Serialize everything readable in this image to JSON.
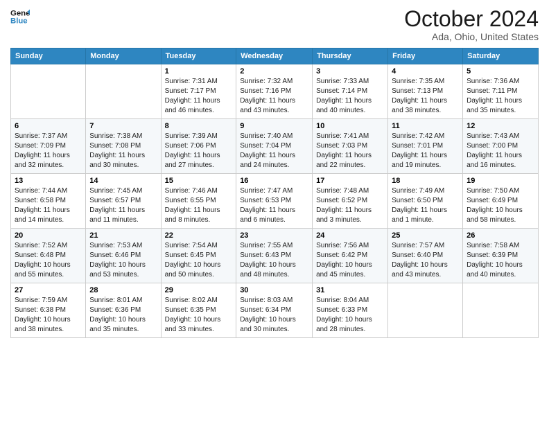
{
  "header": {
    "logo_line1": "General",
    "logo_line2": "Blue",
    "title": "October 2024",
    "subtitle": "Ada, Ohio, United States"
  },
  "days_of_week": [
    "Sunday",
    "Monday",
    "Tuesday",
    "Wednesday",
    "Thursday",
    "Friday",
    "Saturday"
  ],
  "weeks": [
    [
      {
        "day": "",
        "info": ""
      },
      {
        "day": "",
        "info": ""
      },
      {
        "day": "1",
        "info": "Sunrise: 7:31 AM\nSunset: 7:17 PM\nDaylight: 11 hours and 46 minutes."
      },
      {
        "day": "2",
        "info": "Sunrise: 7:32 AM\nSunset: 7:16 PM\nDaylight: 11 hours and 43 minutes."
      },
      {
        "day": "3",
        "info": "Sunrise: 7:33 AM\nSunset: 7:14 PM\nDaylight: 11 hours and 40 minutes."
      },
      {
        "day": "4",
        "info": "Sunrise: 7:35 AM\nSunset: 7:13 PM\nDaylight: 11 hours and 38 minutes."
      },
      {
        "day": "5",
        "info": "Sunrise: 7:36 AM\nSunset: 7:11 PM\nDaylight: 11 hours and 35 minutes."
      }
    ],
    [
      {
        "day": "6",
        "info": "Sunrise: 7:37 AM\nSunset: 7:09 PM\nDaylight: 11 hours and 32 minutes."
      },
      {
        "day": "7",
        "info": "Sunrise: 7:38 AM\nSunset: 7:08 PM\nDaylight: 11 hours and 30 minutes."
      },
      {
        "day": "8",
        "info": "Sunrise: 7:39 AM\nSunset: 7:06 PM\nDaylight: 11 hours and 27 minutes."
      },
      {
        "day": "9",
        "info": "Sunrise: 7:40 AM\nSunset: 7:04 PM\nDaylight: 11 hours and 24 minutes."
      },
      {
        "day": "10",
        "info": "Sunrise: 7:41 AM\nSunset: 7:03 PM\nDaylight: 11 hours and 22 minutes."
      },
      {
        "day": "11",
        "info": "Sunrise: 7:42 AM\nSunset: 7:01 PM\nDaylight: 11 hours and 19 minutes."
      },
      {
        "day": "12",
        "info": "Sunrise: 7:43 AM\nSunset: 7:00 PM\nDaylight: 11 hours and 16 minutes."
      }
    ],
    [
      {
        "day": "13",
        "info": "Sunrise: 7:44 AM\nSunset: 6:58 PM\nDaylight: 11 hours and 14 minutes."
      },
      {
        "day": "14",
        "info": "Sunrise: 7:45 AM\nSunset: 6:57 PM\nDaylight: 11 hours and 11 minutes."
      },
      {
        "day": "15",
        "info": "Sunrise: 7:46 AM\nSunset: 6:55 PM\nDaylight: 11 hours and 8 minutes."
      },
      {
        "day": "16",
        "info": "Sunrise: 7:47 AM\nSunset: 6:53 PM\nDaylight: 11 hours and 6 minutes."
      },
      {
        "day": "17",
        "info": "Sunrise: 7:48 AM\nSunset: 6:52 PM\nDaylight: 11 hours and 3 minutes."
      },
      {
        "day": "18",
        "info": "Sunrise: 7:49 AM\nSunset: 6:50 PM\nDaylight: 11 hours and 1 minute."
      },
      {
        "day": "19",
        "info": "Sunrise: 7:50 AM\nSunset: 6:49 PM\nDaylight: 10 hours and 58 minutes."
      }
    ],
    [
      {
        "day": "20",
        "info": "Sunrise: 7:52 AM\nSunset: 6:48 PM\nDaylight: 10 hours and 55 minutes."
      },
      {
        "day": "21",
        "info": "Sunrise: 7:53 AM\nSunset: 6:46 PM\nDaylight: 10 hours and 53 minutes."
      },
      {
        "day": "22",
        "info": "Sunrise: 7:54 AM\nSunset: 6:45 PM\nDaylight: 10 hours and 50 minutes."
      },
      {
        "day": "23",
        "info": "Sunrise: 7:55 AM\nSunset: 6:43 PM\nDaylight: 10 hours and 48 minutes."
      },
      {
        "day": "24",
        "info": "Sunrise: 7:56 AM\nSunset: 6:42 PM\nDaylight: 10 hours and 45 minutes."
      },
      {
        "day": "25",
        "info": "Sunrise: 7:57 AM\nSunset: 6:40 PM\nDaylight: 10 hours and 43 minutes."
      },
      {
        "day": "26",
        "info": "Sunrise: 7:58 AM\nSunset: 6:39 PM\nDaylight: 10 hours and 40 minutes."
      }
    ],
    [
      {
        "day": "27",
        "info": "Sunrise: 7:59 AM\nSunset: 6:38 PM\nDaylight: 10 hours and 38 minutes."
      },
      {
        "day": "28",
        "info": "Sunrise: 8:01 AM\nSunset: 6:36 PM\nDaylight: 10 hours and 35 minutes."
      },
      {
        "day": "29",
        "info": "Sunrise: 8:02 AM\nSunset: 6:35 PM\nDaylight: 10 hours and 33 minutes."
      },
      {
        "day": "30",
        "info": "Sunrise: 8:03 AM\nSunset: 6:34 PM\nDaylight: 10 hours and 30 minutes."
      },
      {
        "day": "31",
        "info": "Sunrise: 8:04 AM\nSunset: 6:33 PM\nDaylight: 10 hours and 28 minutes."
      },
      {
        "day": "",
        "info": ""
      },
      {
        "day": "",
        "info": ""
      }
    ]
  ]
}
